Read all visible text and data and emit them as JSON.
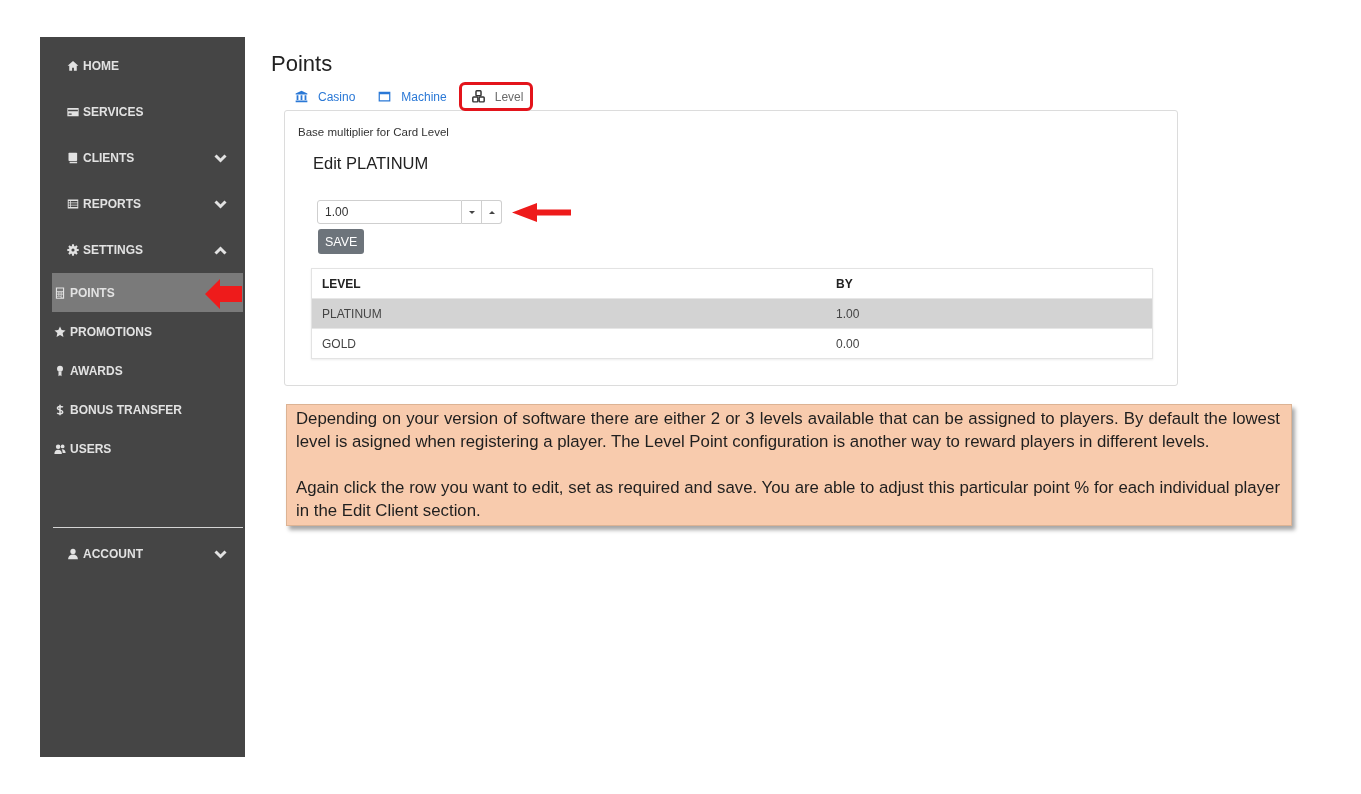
{
  "sidebar": {
    "items": [
      {
        "kind": "link",
        "label": "HOME",
        "selected": false
      },
      {
        "kind": "link",
        "label": "SERVICES",
        "selected": false
      },
      {
        "kind": "group",
        "label": "CLIENTS",
        "selected": false,
        "expanded": false
      },
      {
        "kind": "group",
        "label": "REPORTS",
        "selected": false,
        "expanded": false
      },
      {
        "kind": "group",
        "label": "SETTINGS",
        "selected": false,
        "expanded": true,
        "children": [
          {
            "label": "POINTS",
            "selected": true
          },
          {
            "label": "PROMOTIONS",
            "selected": false
          },
          {
            "label": "AWARDS",
            "selected": false
          },
          {
            "label": "BONUS TRANSFER",
            "selected": false
          },
          {
            "label": "USERS",
            "selected": false
          }
        ]
      }
    ],
    "account": {
      "label": "ACCOUNT",
      "expanded": false
    }
  },
  "page_title": "Points",
  "tabs": [
    {
      "label": "Casino",
      "selected": false
    },
    {
      "label": "Machine",
      "selected": false
    },
    {
      "label": "Level",
      "selected": true
    }
  ],
  "panel": {
    "caption": "Base multiplier for Card Level",
    "edit_title": "Edit PLATINUM",
    "spinner": {
      "value": "1.00"
    },
    "save_button": "SAVE",
    "table": {
      "columns": [
        "LEVEL",
        "BY"
      ],
      "rows": [
        {
          "cells": [
            "PLATINUM",
            "1.00"
          ],
          "selected": true
        },
        {
          "cells": [
            "GOLD",
            "0.00"
          ],
          "selected": false
        }
      ]
    }
  },
  "note": {
    "paragraphs": [
      "Depending on your version of software there are either 2 or 3 levels available that can be assigned to players. By default the lowest level is asigned when registering a player. The Level Point configuration is another way to reward players in different levels.",
      "Again click the row you want to edit, set as required and save. You are able to adjust this particular point % for each individual player in the Edit Client section."
    ]
  }
}
